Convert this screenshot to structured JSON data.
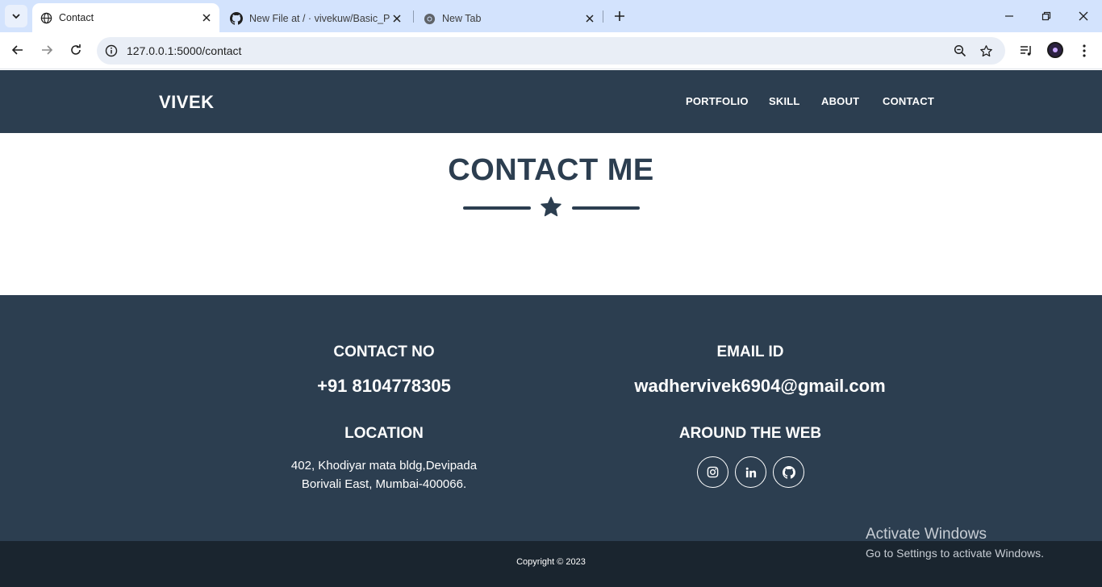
{
  "browser": {
    "tabs": [
      {
        "title": "Contact",
        "icon": "globe-icon",
        "active": true
      },
      {
        "title": "New File at / · vivekuw/Basic_Po",
        "icon": "github-icon",
        "active": false
      },
      {
        "title": "New Tab",
        "icon": "chrome-icon",
        "active": false
      }
    ],
    "url": "127.0.0.1:5000/contact"
  },
  "site": {
    "brand": "VIVEK",
    "menu": [
      "PORTFOLIO",
      "SKILL",
      "ABOUT",
      "CONTACT"
    ],
    "heading": "CONTACT ME"
  },
  "footer": {
    "contact_no_label": "CONTACT NO",
    "contact_no": "+91 8104778305",
    "email_label": "EMAIL ID",
    "email": "wadhervivek6904@gmail.com",
    "location_label": "LOCATION",
    "address_line1": "402, Khodiyar mata bldg,Devipada",
    "address_line2": "Borivali East, Mumbai-400066.",
    "web_label": "AROUND THE WEB",
    "social_icons": [
      "instagram-icon",
      "linkedin-icon",
      "github-icon"
    ],
    "copyright": "Copyright © 2023"
  },
  "watermark": {
    "line1": "Activate Windows",
    "line2": "Go to Settings to activate Windows."
  },
  "colors": {
    "primary": "#2c3e50",
    "copyright_bar": "#1a252f",
    "tab_strip": "#d3e3fd"
  }
}
